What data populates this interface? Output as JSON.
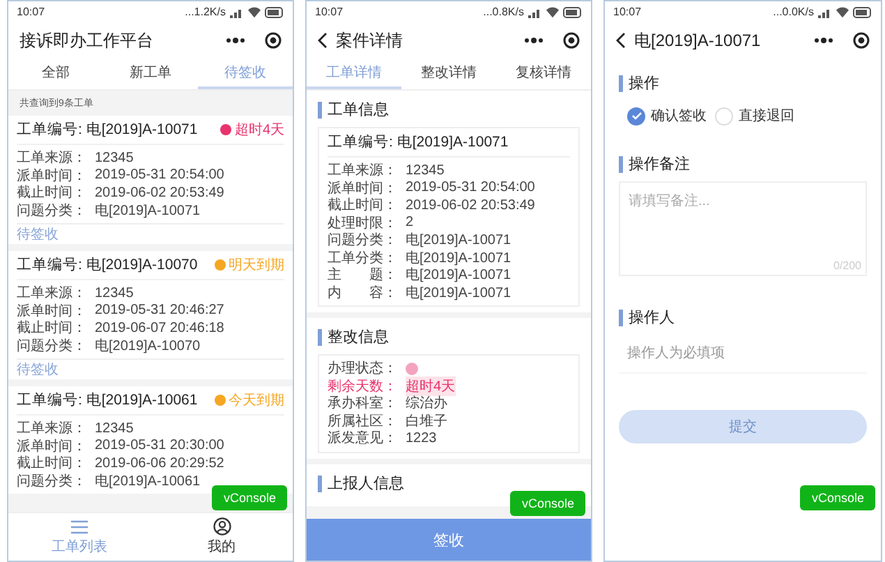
{
  "list_screen": {
    "status_bar": {
      "time": "10:07",
      "speed": "...1.2K/s"
    },
    "title": "接诉即办工作平台",
    "tabs": [
      {
        "label": "全部",
        "selected": false
      },
      {
        "label": "新工单",
        "selected": false
      },
      {
        "label": "待签收",
        "selected": true
      }
    ],
    "result_count": "共查询到9条工单",
    "cards": [
      {
        "title": "工单编号: 电[2019]A-10071",
        "badge": "超时4天",
        "color": "#e8336d",
        "rows": [
          [
            "工单来源：",
            "12345"
          ],
          [
            "派单时间：",
            "2019-05-31 20:54:00"
          ],
          [
            "截止时间：",
            "2019-06-02 20:53:49"
          ],
          [
            "问题分类：",
            "电[2019]A-10071"
          ]
        ],
        "footer": "待签收"
      },
      {
        "title": "工单编号: 电[2019]A-10070",
        "badge": "明天到期",
        "color": "#f5a623",
        "rows": [
          [
            "工单来源：",
            "12345"
          ],
          [
            "派单时间：",
            "2019-05-31 20:46:27"
          ],
          [
            "截止时间：",
            "2019-06-07 20:46:18"
          ],
          [
            "问题分类：",
            "电[2019]A-10070"
          ]
        ],
        "footer": "待签收"
      },
      {
        "title": "工单编号: 电[2019]A-10061",
        "badge": "今天到期",
        "color": "#f5a623",
        "rows": [
          [
            "工单来源：",
            "12345"
          ],
          [
            "派单时间：",
            "2019-05-31 20:30:00"
          ],
          [
            "截止时间：",
            "2019-06-06 20:29:52"
          ],
          [
            "问题分类：",
            "电[2019]A-10061"
          ]
        ]
      }
    ],
    "console_button": "vConsole",
    "nav": [
      {
        "label": "工单列表",
        "kind": "list",
        "selected": true
      },
      {
        "label": "我的",
        "kind": "user",
        "selected": false
      }
    ]
  },
  "detail_screen": {
    "status_bar": {
      "time": "10:07",
      "speed": "...0.8K/s"
    },
    "title": "案件详情",
    "tabs": [
      {
        "label": "工单详情",
        "selected": true
      },
      {
        "label": "整改详情",
        "selected": false
      },
      {
        "label": "复核详情",
        "selected": false
      }
    ],
    "order_section": {
      "heading": "工单信息",
      "card_title": "工单编号: 电[2019]A-10071",
      "rows": [
        [
          "工单来源：",
          "12345"
        ],
        [
          "派单时间：",
          "2019-05-31 20:54:00"
        ],
        [
          "截止时间：",
          "2019-06-02 20:53:49"
        ],
        [
          "处理时限：",
          "2"
        ],
        [
          "问题分类：",
          "电[2019]A-10071"
        ],
        [
          "工单分类：",
          "电[2019]A-10071"
        ],
        [
          "主　　题：",
          "电[2019]A-10071"
        ],
        [
          "内　　容：",
          "电[2019]A-10071"
        ]
      ]
    },
    "fix_section": {
      "heading": "整改信息",
      "rows": [
        {
          "kind": "status",
          "label": "办理状态：",
          "color": "#f4a3bf"
        },
        {
          "kind": "alert",
          "label": "剩余天数：",
          "value": "超时4天"
        },
        {
          "kind": "text",
          "label": "承办科室：",
          "value": "综治办"
        },
        {
          "kind": "text",
          "label": "所属社区：",
          "value": "白堆子"
        },
        {
          "kind": "text",
          "label": "派发意见：",
          "value": "1223"
        }
      ]
    },
    "reporter_section": {
      "heading": "上报人信息"
    },
    "sign_button": "签收",
    "console_button": "vConsole"
  },
  "action_screen": {
    "status_bar": {
      "time": "10:07",
      "speed": "...0.0K/s"
    },
    "title": "电[2019]A-10071",
    "operation": {
      "heading": "操作",
      "options": [
        {
          "label": "确认签收",
          "selected": true
        },
        {
          "label": "直接退回",
          "selected": false
        }
      ]
    },
    "remark": {
      "heading": "操作备注",
      "placeholder": "请填写备注...",
      "counter": "0/200"
    },
    "operator": {
      "heading": "操作人",
      "placeholder": "操作人为必填项"
    },
    "submit": {
      "label": "提交",
      "disabled": true
    },
    "console_button": "vConsole"
  }
}
